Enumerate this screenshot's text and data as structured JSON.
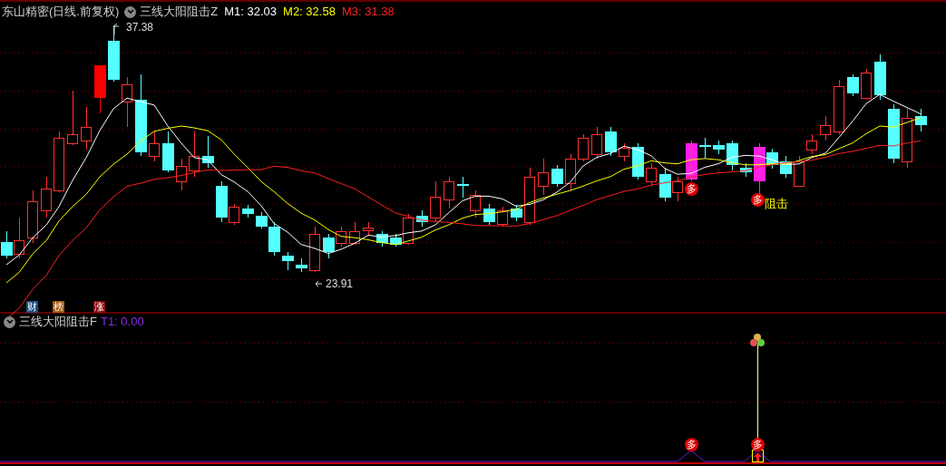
{
  "top_bar": {
    "stock": "东山精密(日线.前复权)",
    "indicator": "三线大阳阻击Z",
    "values": [
      {
        "label": "M1: 32.03",
        "color": "#ffffff"
      },
      {
        "label": "M2: 32.58",
        "color": "#ffff00"
      },
      {
        "label": "M3: 31.38",
        "color": "#ff2020"
      }
    ]
  },
  "price_chart": {
    "high_label": "37.38",
    "low_label": "23.91",
    "badges": [
      {
        "text": "财",
        "color": "#1b4f7e"
      },
      {
        "text": "榜",
        "color": "#a35a0c"
      },
      {
        "text": "涨",
        "color": "#8c0c0c"
      }
    ],
    "signals": [
      {
        "text": "多"
      },
      {
        "text": "多"
      }
    ],
    "resist_label": "阻击"
  },
  "sub_panel": {
    "indicator": "三线大阳阻击F",
    "value": "T1: 0.00",
    "signals": [
      {
        "text": "多"
      },
      {
        "text": "多"
      }
    ]
  }
}
